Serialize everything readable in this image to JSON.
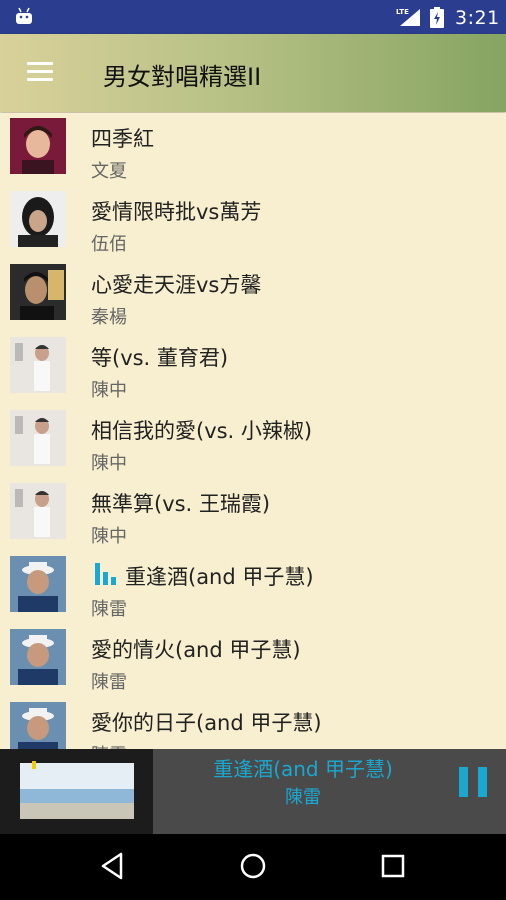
{
  "status_bar": {
    "time": "3:21",
    "network": "LTE",
    "icons": [
      "android-icon",
      "lte-signal-icon",
      "battery-icon"
    ]
  },
  "app_bar": {
    "title": "男女對唱精選II",
    "menu_icon": "hamburger-menu-icon"
  },
  "songs": [
    {
      "title": "四季紅",
      "artist": "文夏"
    },
    {
      "title": "愛情限時批vs萬芳",
      "artist": "伍佰"
    },
    {
      "title": "心愛走天涯vs方馨",
      "artist": "秦楊"
    },
    {
      "title": "等(vs. 董育君)",
      "artist": "陳中"
    },
    {
      "title": "相信我的愛(vs. 小辣椒)",
      "artist": "陳中"
    },
    {
      "title": "無準算(vs. 王瑞霞)",
      "artist": "陳中"
    },
    {
      "title": "重逢酒(and 甲子慧)",
      "artist": "陳雷",
      "playing": true
    },
    {
      "title": "愛的情火(and 甲子慧)",
      "artist": "陳雷"
    },
    {
      "title": "愛你的日子(and 甲子慧)",
      "artist": "陳雷"
    }
  ],
  "now_playing": {
    "title": "重逢酒(and 甲子慧)",
    "artist": "陳雷",
    "control": "pause-icon"
  },
  "colors": {
    "status_bar": "#2b3d8f",
    "accent": "#1aa8d1",
    "list_background": "#f7efcf",
    "divider": "#f0d890"
  },
  "nav_bar": {
    "icons": [
      "back-icon",
      "home-icon",
      "recents-icon"
    ]
  }
}
